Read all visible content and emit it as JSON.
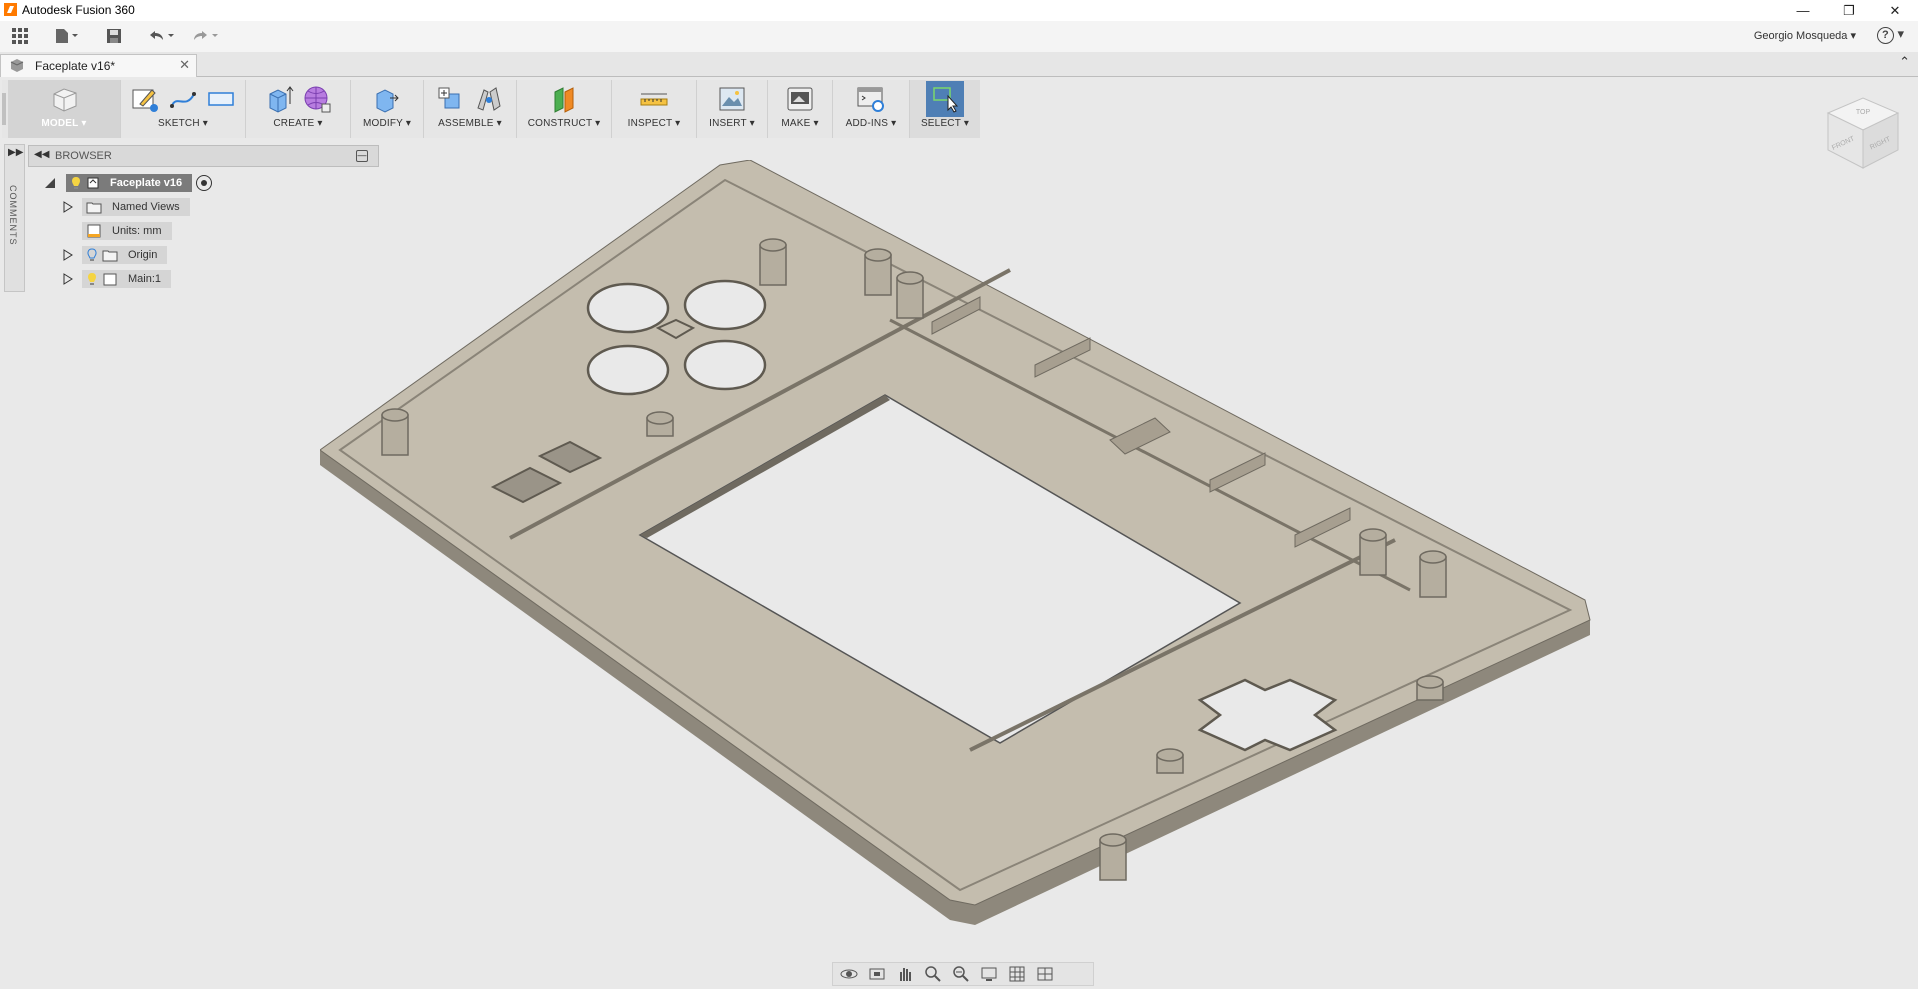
{
  "window": {
    "title": "Autodesk Fusion 360",
    "controls": [
      "minimize-icon",
      "restore-icon",
      "close-icon"
    ]
  },
  "quick_access": {
    "user_name": "Georgio Mosqueda",
    "help_label": "?"
  },
  "document_tab": {
    "label": "Faceplate v16*"
  },
  "toolbar": {
    "workspace": "MODEL",
    "groups": [
      {
        "label": "SKETCH"
      },
      {
        "label": "CREATE"
      },
      {
        "label": "MODIFY"
      },
      {
        "label": "ASSEMBLE"
      },
      {
        "label": "CONSTRUCT"
      },
      {
        "label": "INSPECT"
      },
      {
        "label": "INSERT"
      },
      {
        "label": "MAKE"
      },
      {
        "label": "ADD-INS"
      },
      {
        "label": "SELECT"
      }
    ]
  },
  "sidebar": {
    "comments_label": "COMMENTS"
  },
  "browser": {
    "title": "BROWSER",
    "items": [
      {
        "label": "Faceplate v16"
      },
      {
        "label": "Named Views"
      },
      {
        "label": "Units: mm"
      },
      {
        "label": "Origin"
      },
      {
        "label": "Main:1"
      }
    ]
  },
  "viewcube": {
    "faces": [
      "TOP",
      "FRONT",
      "RIGHT"
    ]
  },
  "colors": {
    "model_top": "#c4bdae",
    "model_side": "#8e887c",
    "selected_tool": "#4f7fb5",
    "browser_root": "#7b7b7b"
  }
}
